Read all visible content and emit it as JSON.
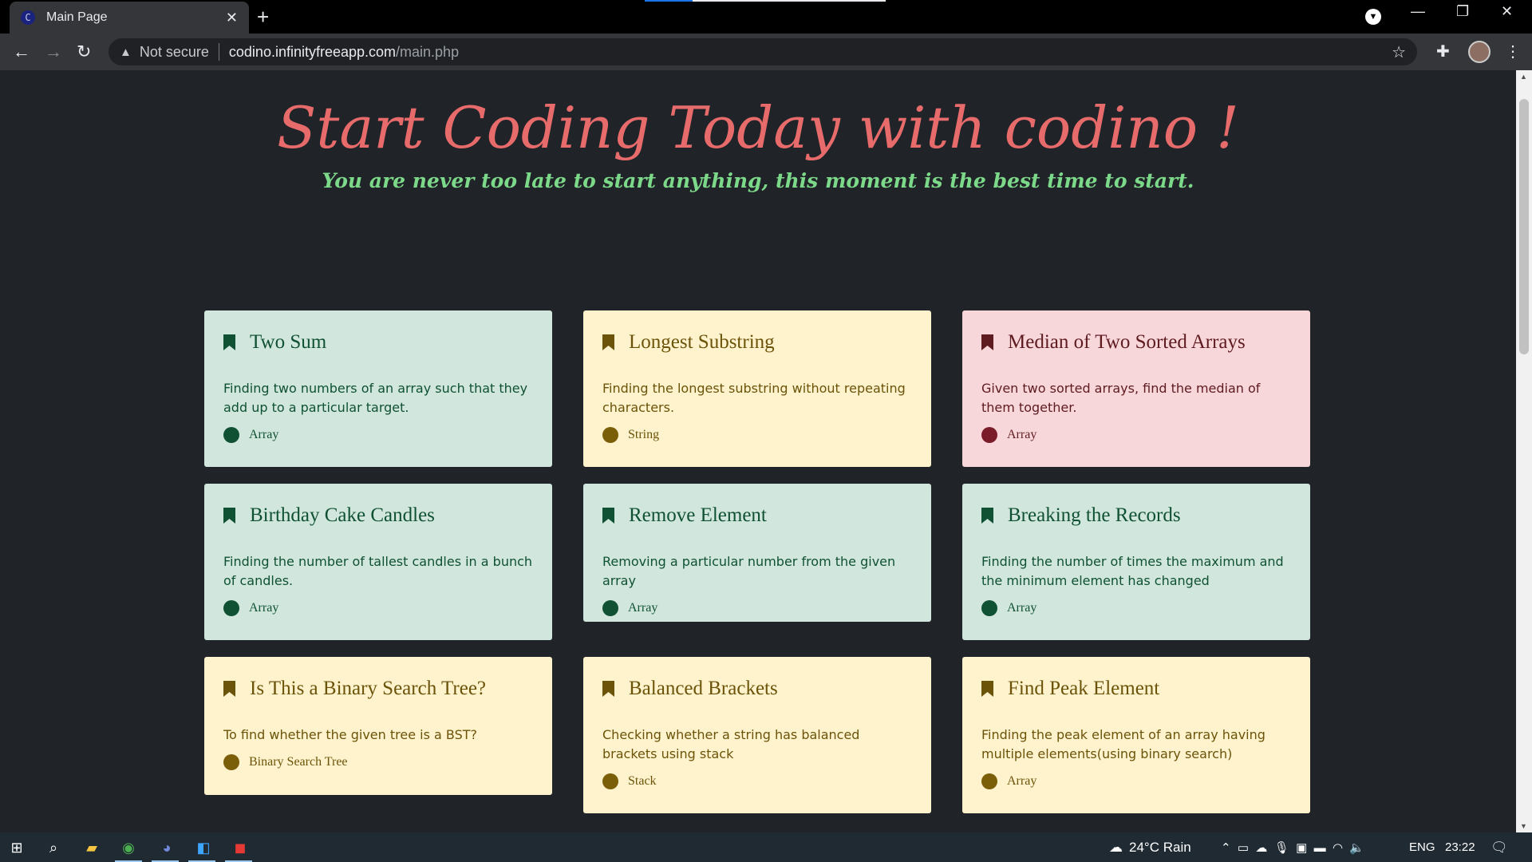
{
  "browser": {
    "tab_title": "Main Page",
    "tab_favicon_letter": "C",
    "security_label": "Not secure",
    "url_host": "codino.infinityfreeapp.com",
    "url_path": "/main.php"
  },
  "hero": {
    "title": "Start Coding Today with codino !",
    "subtitle": "You are never too late to start anything, this moment is the best time to start."
  },
  "cards": [
    {
      "title": "Two Sum",
      "description": "Finding two numbers of an array such that they add up to a particular target.",
      "tag": "Array",
      "color": "green"
    },
    {
      "title": "Longest Substring",
      "description": "Finding the longest substring without repeating characters.",
      "tag": "String",
      "color": "yellow"
    },
    {
      "title": "Median of Two Sorted Arrays",
      "description": "Given two sorted arrays, find the median of them together.",
      "tag": "Array",
      "color": "pink"
    },
    {
      "title": "Birthday Cake Candles",
      "description": "Finding the number of tallest candles in a bunch of candles.",
      "tag": "Array",
      "color": "green"
    },
    {
      "title": "Remove Element",
      "description": "Removing a particular number from the given array",
      "tag": "Array",
      "color": "green"
    },
    {
      "title": "Breaking the Records",
      "description": "Finding the number of times the maximum and the minimum element has changed",
      "tag": "Array",
      "color": "green"
    },
    {
      "title": "Is This a Binary Search Tree?",
      "description": "To find whether the given tree is a BST?",
      "tag": "Binary Search Tree",
      "color": "yellow"
    },
    {
      "title": "Balanced Brackets",
      "description": "Checking whether a string has balanced brackets using stack",
      "tag": "Stack",
      "color": "yellow"
    },
    {
      "title": "Find Peak Element",
      "description": "Finding the peak element of an array having multiple elements(using binary search)",
      "tag": "Array",
      "color": "yellow"
    }
  ],
  "taskbar": {
    "weather": "24°C  Rain",
    "language": "ENG",
    "time": "23:22"
  }
}
